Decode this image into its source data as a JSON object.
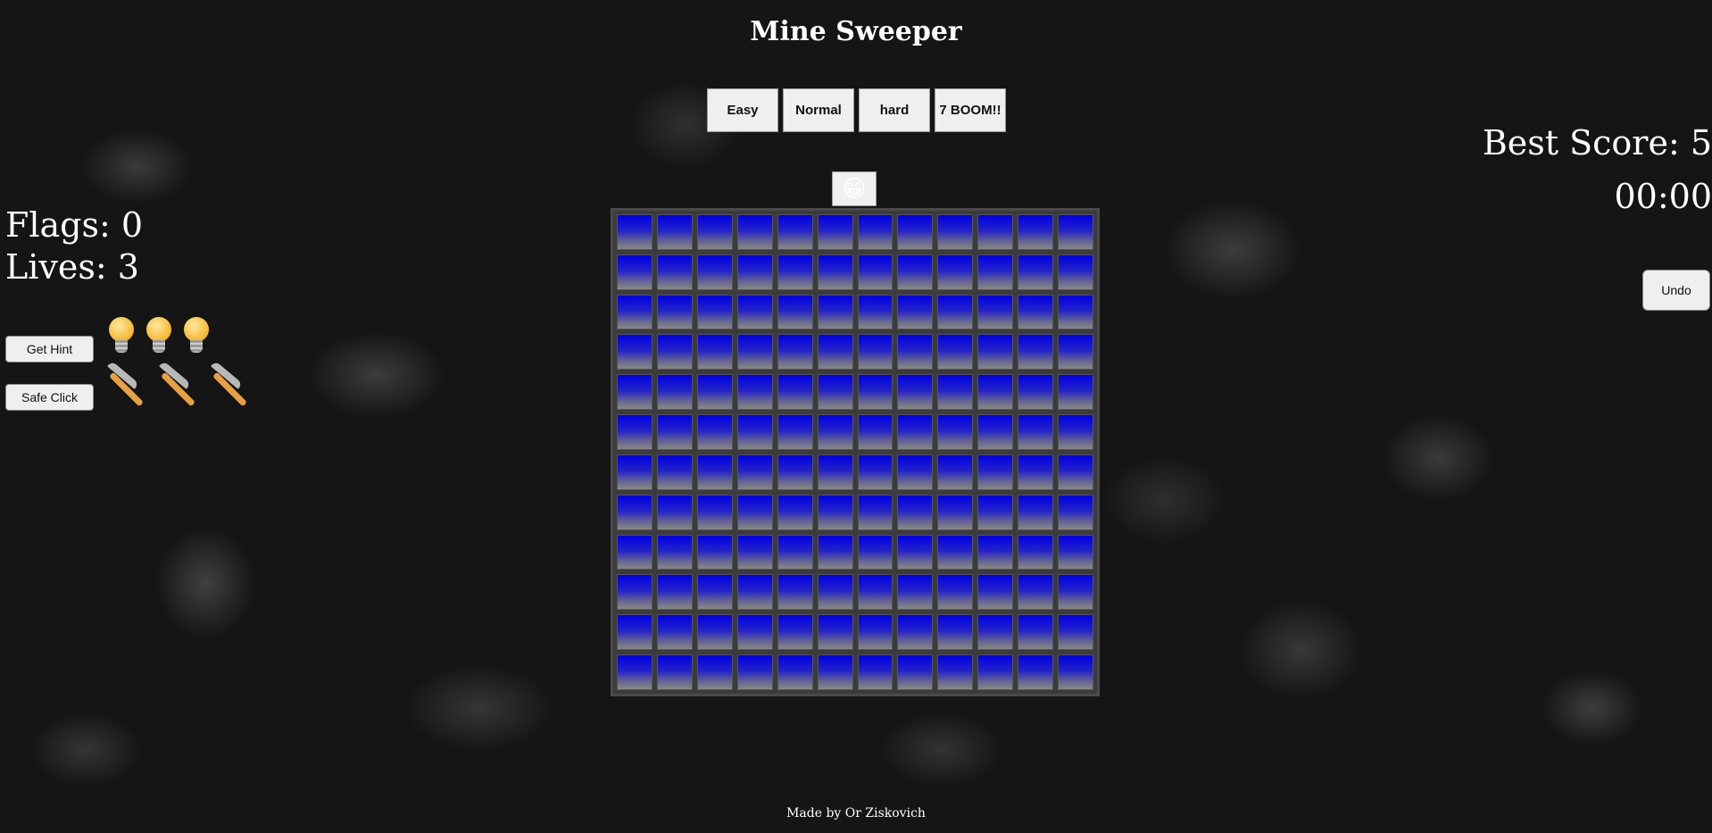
{
  "header": {
    "title": "Mine Sweeper"
  },
  "levels": [
    {
      "label": "Easy"
    },
    {
      "label": "Normal"
    },
    {
      "label": "hard"
    },
    {
      "label": "7 BOOM!!"
    }
  ],
  "smiley": {
    "icon": "grinning-face-icon",
    "glyph": "😁"
  },
  "stats": {
    "flags": "Flags: 0",
    "lives": "Lives: 3",
    "best_score": "Best Score: 5",
    "timer": "00:00"
  },
  "actions": {
    "hint_label": "Get Hint",
    "safe_click_label": "Safe Click",
    "undo_label": "Undo",
    "hints_remaining": 3,
    "safe_clicks_remaining": 3
  },
  "board": {
    "rows": 12,
    "cols": 12,
    "cell_state": "unrevealed",
    "cell_color_top": "#0000e6",
    "cell_color_bottom": "#888888"
  },
  "footer": {
    "credit": "Made by Or Ziskovich"
  }
}
